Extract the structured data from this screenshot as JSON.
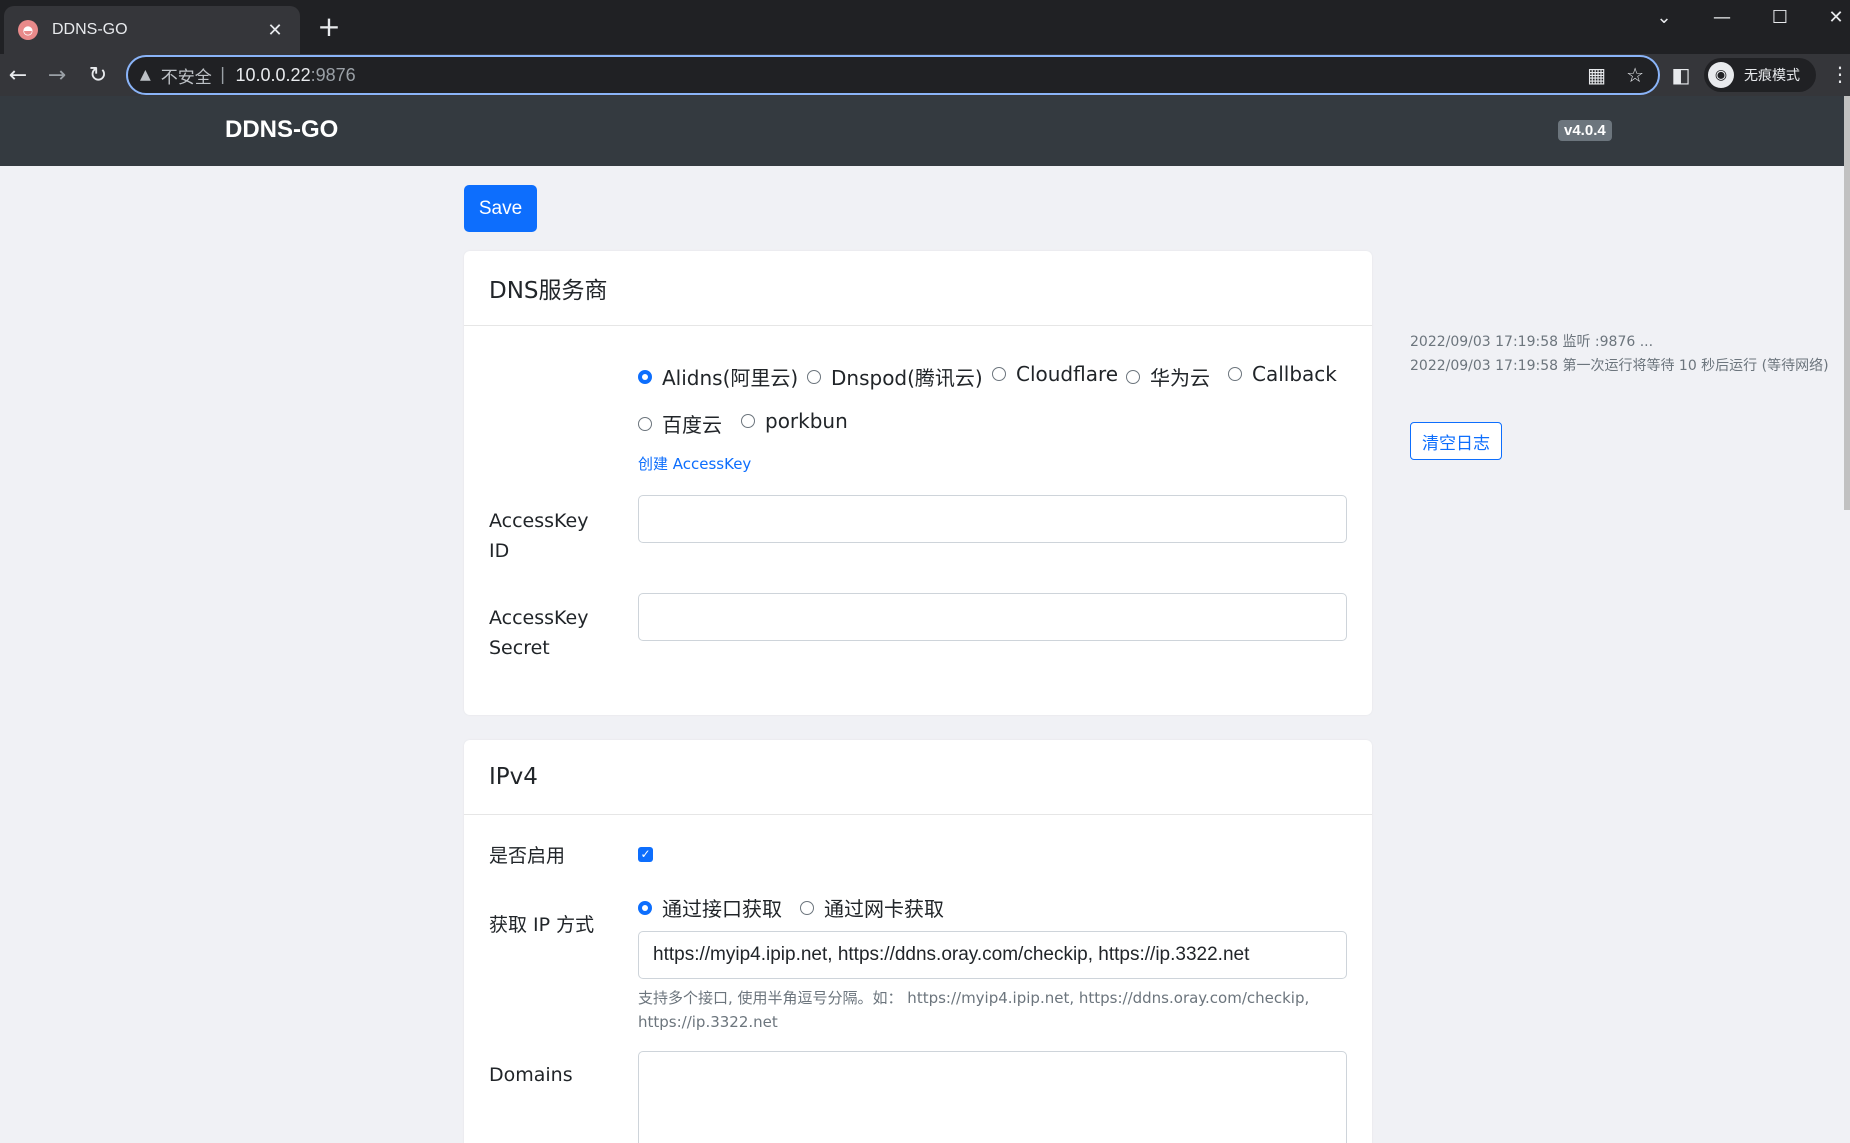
{
  "browser": {
    "tab_title": "DDNS-GO",
    "tab_favicon": "ghost-favicon",
    "address": {
      "security_label": "不安全",
      "host": "10.0.0.22",
      "port": ":9876"
    },
    "profile_label": "无痕模式"
  },
  "app": {
    "brand": "DDNS-GO",
    "version": "v4.0.4",
    "save_label": "Save"
  },
  "dns_card": {
    "title": "DNS服务商",
    "providers": [
      {
        "label": "Alidns(阿里云)",
        "checked": true
      },
      {
        "label": "Dnspod(腾讯云)",
        "checked": false
      },
      {
        "label": "Cloudflare",
        "checked": false
      },
      {
        "label": "华为云",
        "checked": false
      },
      {
        "label": "Callback",
        "checked": false
      },
      {
        "label": "百度云",
        "checked": false
      },
      {
        "label": "porkbun",
        "checked": false
      }
    ],
    "create_key_link": "创建 AccessKey",
    "access_key_id_label_1": "AccessKey",
    "access_key_id_label_2": "ID",
    "access_key_id_value": "",
    "access_key_secret_label_1": "AccessKey",
    "access_key_secret_label_2": "Secret",
    "access_key_secret_value": ""
  },
  "ipv4_card": {
    "title": "IPv4",
    "enable_label": "是否启用",
    "enabled": true,
    "get_ip_label": "获取 IP 方式",
    "get_ip_options": [
      {
        "label": "通过接口获取",
        "checked": true
      },
      {
        "label": "通过网卡获取",
        "checked": false
      }
    ],
    "url_value": "https://myip4.ipip.net, https://ddns.oray.com/checkip, https://ip.3322.net",
    "url_help": "支持多个接口, 使用半角逗号分隔。如： https://myip4.ipip.net, https://ddns.oray.com/checkip, https://ip.3322.net",
    "domains_label": "Domains",
    "domains_value": ""
  },
  "log": {
    "lines": [
      "2022/09/03 17:19:58 监听 :9876 ...",
      "2022/09/03 17:19:58 第一次运行将等待 10 秒后运行 (等待网络)"
    ],
    "clear_label": "清空日志"
  },
  "colors": {
    "primary": "#0d6efd",
    "navbar": "#343a40",
    "page_bg": "#f0f1f5"
  }
}
